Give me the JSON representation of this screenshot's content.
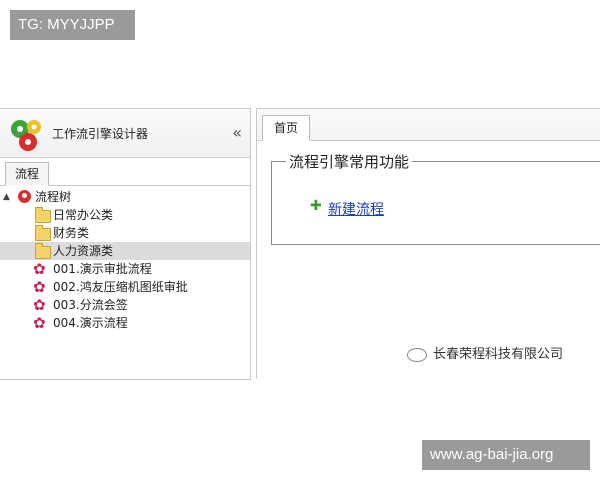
{
  "watermark_top": "TG: MYYJJPP",
  "watermark_bottom": "www.ag-bai-jia.org",
  "app": {
    "title": "工作流引擎设计器",
    "collapse": "«"
  },
  "left_tab": {
    "label": "流程"
  },
  "tree": {
    "root": {
      "label": "流程树",
      "toggle": "▲"
    },
    "folders": [
      {
        "label": "日常办公类"
      },
      {
        "label": "财务类"
      },
      {
        "label": "人力资源类"
      }
    ],
    "flows": [
      {
        "label": "001.演示审批流程"
      },
      {
        "label": "002.鸿友压缩机图纸审批"
      },
      {
        "label": "003.分流会签"
      },
      {
        "label": "004.演示流程"
      }
    ]
  },
  "right_tab": {
    "label": "首页"
  },
  "functions": {
    "legend": "流程引擎常用功能",
    "new_flow": "新建流程"
  },
  "corner_watermark": "长春荣程科技有限公司",
  "colors": {
    "gear": "#c8205d",
    "link": "#1a3eb8",
    "plus": "#3b9b2a"
  }
}
